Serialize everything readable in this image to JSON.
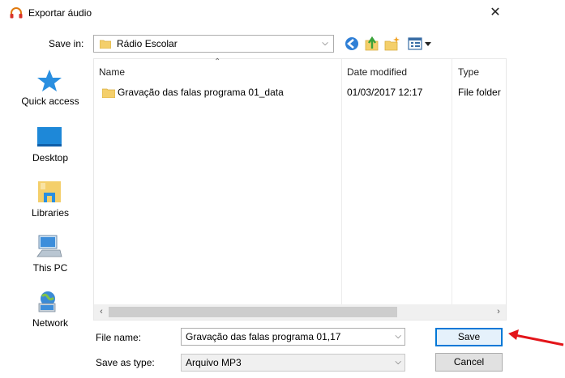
{
  "window": {
    "title": "Exportar áudio",
    "close_glyph": "✕"
  },
  "toolbar": {
    "save_in_label": "Save in:",
    "save_in_value": "Rádio Escolar",
    "icons": [
      "back-icon",
      "up-folder-icon",
      "new-folder-icon",
      "views-menu-icon"
    ]
  },
  "places": [
    {
      "label": "Quick access",
      "icon": "star-icon"
    },
    {
      "label": "Desktop",
      "icon": "desktop-icon"
    },
    {
      "label": "Libraries",
      "icon": "libraries-icon"
    },
    {
      "label": "This PC",
      "icon": "computer-icon"
    },
    {
      "label": "Network",
      "icon": "network-icon"
    }
  ],
  "file_list": {
    "columns": [
      "Name",
      "Date modified",
      "Type"
    ],
    "rows": [
      {
        "name": "Gravação das falas programa 01_data",
        "date": "01/03/2017 12:17",
        "type": "File folder"
      }
    ]
  },
  "form": {
    "file_name_label": "File name:",
    "file_name_value": "Gravação das falas programa 01,17",
    "save_as_type_label": "Save as type:",
    "save_as_type_value": "Arquivo MP3"
  },
  "buttons": {
    "save": "Save",
    "cancel": "Cancel"
  },
  "colors": {
    "accent": "#0078d7",
    "folder": "#f4cf6b",
    "annotation_arrow": "#e3151a"
  }
}
